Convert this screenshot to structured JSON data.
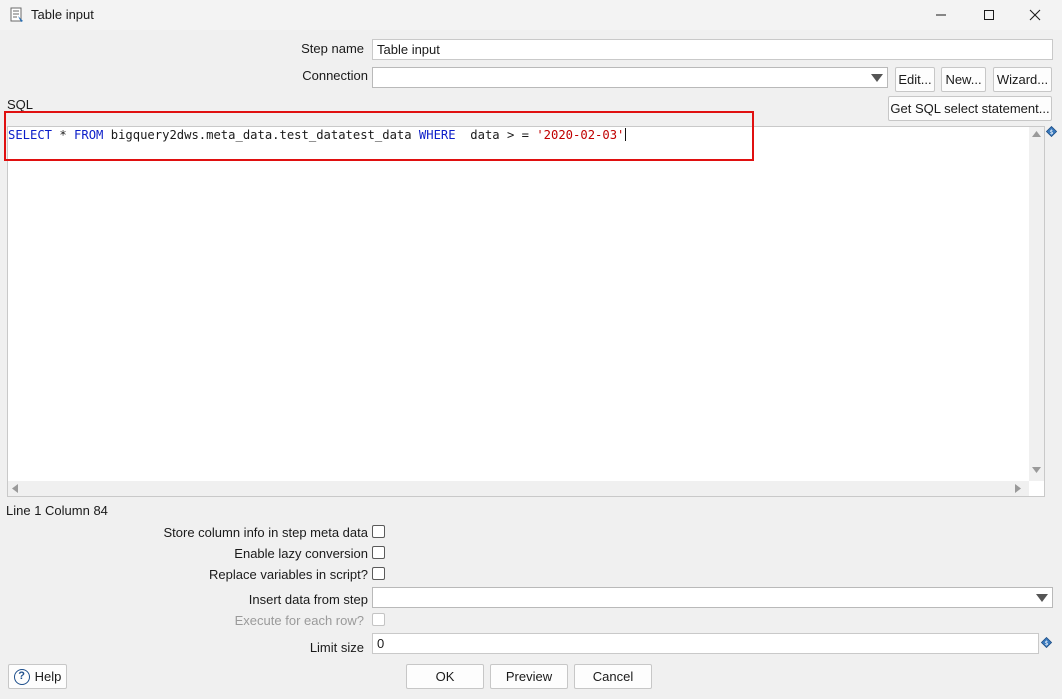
{
  "window": {
    "title": "Table input",
    "minimize_glyph": "—",
    "close_glyph": "✕"
  },
  "form": {
    "step_name_label": "Step name",
    "step_name_value": "Table input",
    "connection_label": "Connection",
    "connection_value": "",
    "edit_label": "Edit...",
    "new_label": "New...",
    "wizard_label": "Wizard...",
    "sql_label": "SQL",
    "get_sql_label": "Get SQL select statement..."
  },
  "sql": {
    "kw_select": "SELECT",
    "star": " * ",
    "kw_from": "FROM",
    "table": " bigquery2dws.meta_data.test_datatest_data ",
    "kw_where": "WHERE",
    "condition": "  data > = ",
    "literal": "'2020-02-03'"
  },
  "status": {
    "cursor_position": "Line 1 Column 84"
  },
  "options": {
    "store_column_info_label": "Store column info in step meta data",
    "enable_lazy_conversion_label": "Enable lazy conversion",
    "replace_variables_label": "Replace variables in script?",
    "insert_data_from_step_label": "Insert data from step",
    "insert_data_from_step_value": "",
    "execute_for_each_row_label": "Execute for each row?",
    "limit_size_label": "Limit size",
    "limit_size_value": "0"
  },
  "footer": {
    "help_label": "Help",
    "ok_label": "OK",
    "preview_label": "Preview",
    "cancel_label": "Cancel"
  },
  "colors": {
    "keyword": "#0b1ec9",
    "string_literal": "#c00000",
    "highlight_box": "#e01010"
  }
}
